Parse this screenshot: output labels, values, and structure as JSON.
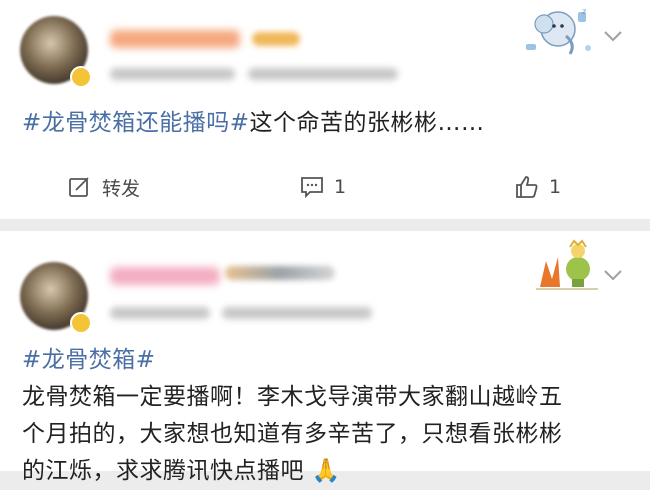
{
  "post1": {
    "hashtag": "#龙骨焚箱还能播吗#",
    "body": "这个命苦的张彬彬……",
    "actions": {
      "repost_label": "转发",
      "comment_count": "1",
      "like_count": "1"
    }
  },
  "post2": {
    "hashtag": "#龙骨焚箱#",
    "body_lines": [
      "龙骨焚箱一定要播啊！李木戈导演带大家翻山越岭五",
      "个月拍的，大家想也知道有多辛苦了，只想看张彬彬",
      "的江烁，求求腾讯快点播吧"
    ],
    "trailing_emoji": "🙏"
  },
  "icons": {
    "repost": "edit-share-icon",
    "comment": "comment-bubble-icon",
    "like": "thumbs-up-icon",
    "more": "chevron-down-icon"
  },
  "colors": {
    "hashtag": "#4a6fa5",
    "text": "#222222",
    "background": "#ececec",
    "card": "#ffffff"
  }
}
